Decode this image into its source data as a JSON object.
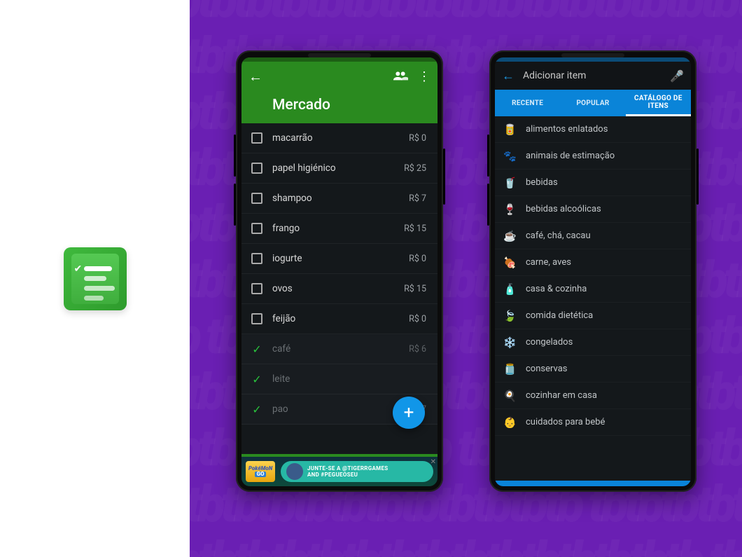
{
  "phone1": {
    "title": "Mercado",
    "currency_prefix": "R$ ",
    "items": [
      {
        "name": "macarrão",
        "price": "0",
        "done": false
      },
      {
        "name": "papel higiénico",
        "price": "25",
        "done": false
      },
      {
        "name": "shampoo",
        "price": "7",
        "done": false
      },
      {
        "name": "frango",
        "price": "15",
        "done": false
      },
      {
        "name": "iogurte",
        "price": "0",
        "done": false
      },
      {
        "name": "ovos",
        "price": "15",
        "done": false
      },
      {
        "name": "feijão",
        "price": "0",
        "done": false
      },
      {
        "name": "café",
        "price": "6",
        "done": true
      },
      {
        "name": "leite",
        "price": "",
        "done": true
      },
      {
        "name": "pao",
        "price": "7",
        "done": true
      }
    ],
    "ad": {
      "logo_top": "PokéMoN",
      "logo_bottom": "GO",
      "text_line1": "JUNTE-SE A @TIGERRGAMES",
      "text_line2": "AND #PEGUEOSEU"
    }
  },
  "phone2": {
    "search_placeholder": "Adicionar item",
    "tabs": [
      {
        "label": "RECENTE",
        "active": false
      },
      {
        "label": "POPULAR",
        "active": false
      },
      {
        "label": "CATÁLOGO DE ITENS",
        "active": true
      }
    ],
    "categories": [
      {
        "icon": "🥫",
        "label": "alimentos enlatados"
      },
      {
        "icon": "🐾",
        "label": "animais de estimação"
      },
      {
        "icon": "🥤",
        "label": "bebidas"
      },
      {
        "icon": "🍷",
        "label": "bebidas alcoólicas"
      },
      {
        "icon": "☕",
        "label": "café, chá, cacau"
      },
      {
        "icon": "🍖",
        "label": "carne, aves"
      },
      {
        "icon": "🧴",
        "label": "casa & cozinha"
      },
      {
        "icon": "🍃",
        "label": "comida dietética"
      },
      {
        "icon": "❄️",
        "label": "congelados"
      },
      {
        "icon": "🫙",
        "label": "conservas"
      },
      {
        "icon": "🍳",
        "label": "cozinhar em casa"
      },
      {
        "icon": "👶",
        "label": "cuidados para bebé"
      }
    ]
  }
}
